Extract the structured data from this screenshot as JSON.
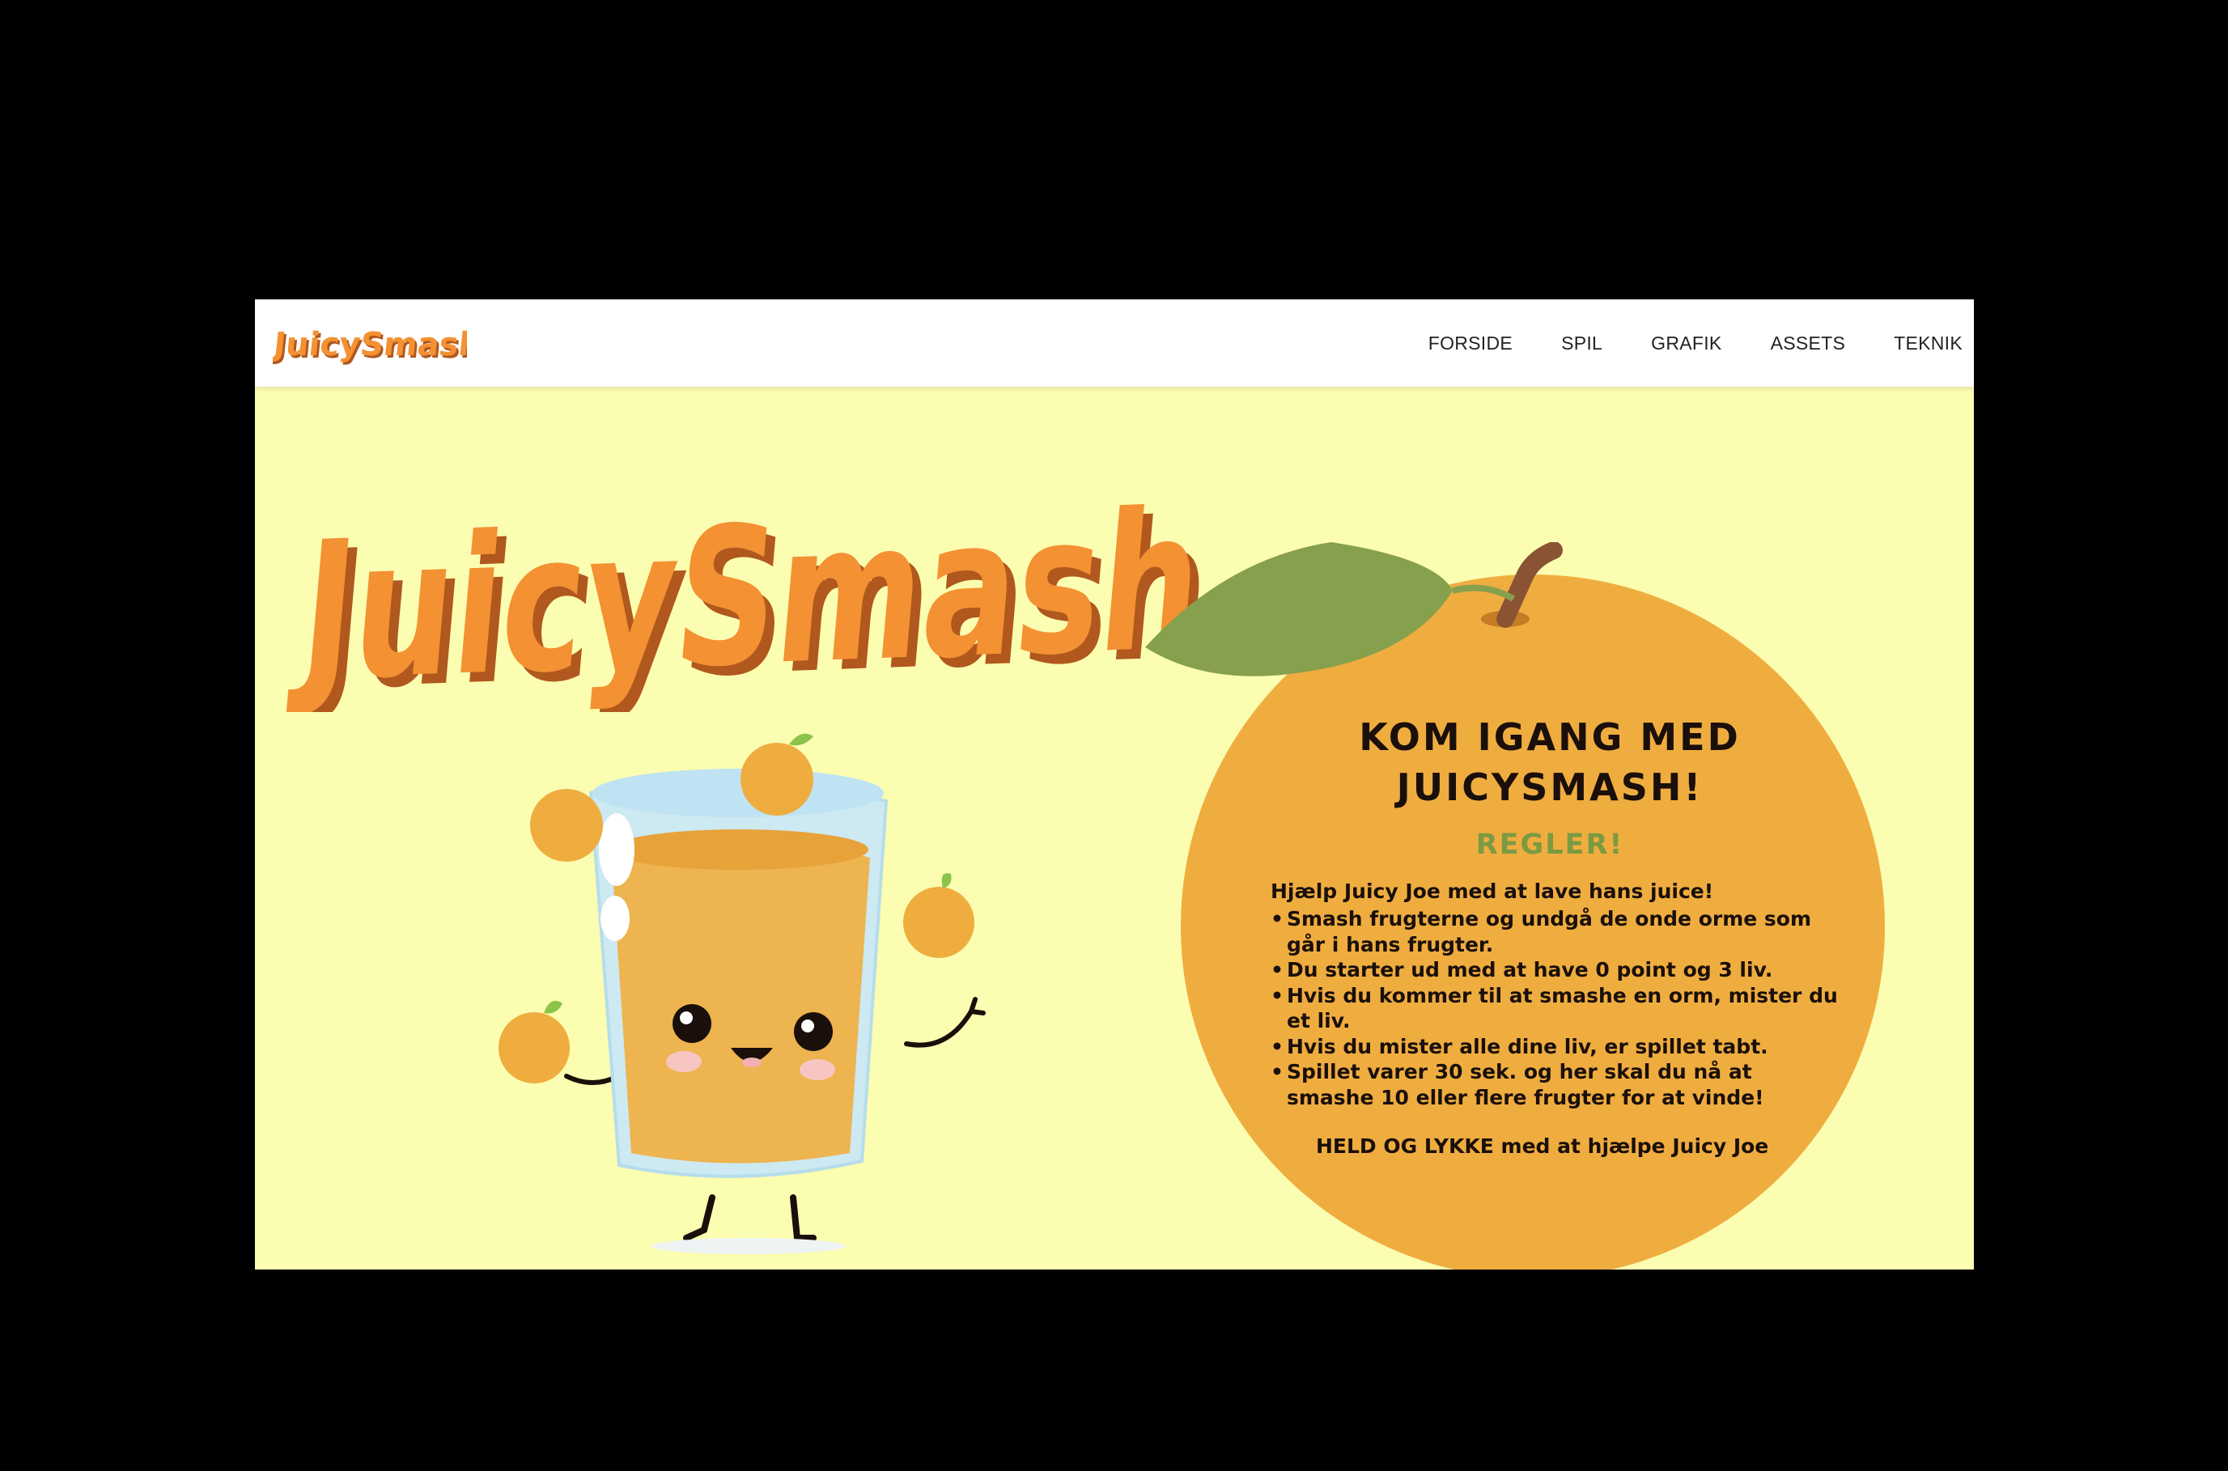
{
  "brand": {
    "logo_text": "JuicySmash",
    "hero_title": "JuicySmash"
  },
  "nav": {
    "items": [
      {
        "label": "FORSIDE"
      },
      {
        "label": "SPIL"
      },
      {
        "label": "GRAFIK"
      },
      {
        "label": "ASSETS"
      },
      {
        "label": "TEKNIK"
      }
    ]
  },
  "rules": {
    "title_line1": "KOM IGANG MED",
    "title_line2": "JUICYSMASH!",
    "subtitle": "REGLER!",
    "intro": "Hjælp Juicy Joe med at lave hans juice!",
    "items": [
      "Smash frugterne og undgå de onde orme som går i hans frugter.",
      "Du starter ud med at have 0 point og 3 liv.",
      "Hvis du kommer til at smashe en orm, mister du et liv.",
      "Hvis du mister alle dine liv, er spillet tabt.",
      "Spillet varer 30 sek. og her skal du nå at smashe 10 eller flere frugter for at vinde!"
    ],
    "outro": "HELD OG LYKKE med at hjælpe Juicy Joe"
  },
  "icons": {
    "logo": "juicysmash-logo",
    "mascot": "juice-glass-mascot",
    "orange": "orange-fruit-icon",
    "leaf": "leaf-icon"
  },
  "colors": {
    "background": "#fbfdb0",
    "title_orange": "#f39133",
    "title_shadow": "#b0581d",
    "orange_fill": "#efad40",
    "leaf_green": "#87a04d",
    "subtitle_green": "#7c9a42",
    "text_dark": "#1a0f0a"
  }
}
